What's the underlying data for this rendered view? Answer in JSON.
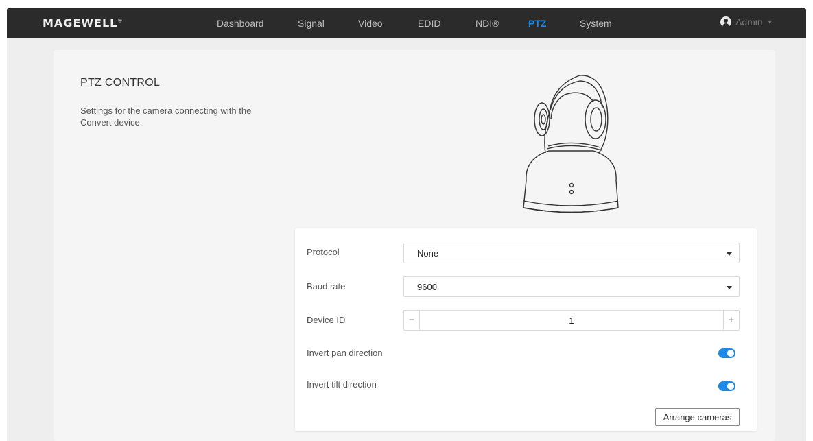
{
  "header": {
    "brand": "MAGEWELL",
    "brand_mark": "®",
    "nav": [
      {
        "label": "Dashboard",
        "active": false
      },
      {
        "label": "Signal",
        "active": false
      },
      {
        "label": "Video",
        "active": false
      },
      {
        "label": "EDID",
        "active": false
      },
      {
        "label": "NDI®",
        "active": false
      },
      {
        "label": "PTZ",
        "active": true
      },
      {
        "label": "System",
        "active": false
      }
    ],
    "user": {
      "name": "Admin",
      "icon": "user-avatar-icon"
    }
  },
  "section": {
    "title": "PTZ CONTROL",
    "description": "Settings for the camera connecting with the Convert device.",
    "illustration": "ptz-camera-icon"
  },
  "form": {
    "protocol": {
      "label": "Protocol",
      "value": "None"
    },
    "baud_rate": {
      "label": "Baud rate",
      "value": "9600"
    },
    "device_id": {
      "label": "Device ID",
      "value": "1",
      "minus": "−",
      "plus": "+"
    },
    "invert_pan": {
      "label": "Invert pan direction",
      "enabled": true
    },
    "invert_tilt": {
      "label": "Invert tilt direction",
      "enabled": true
    },
    "arrange_button": "Arrange cameras"
  },
  "colors": {
    "accent": "#1e88e5",
    "topbar": "#2b2b2b",
    "page_bg": "#eeeeee"
  }
}
